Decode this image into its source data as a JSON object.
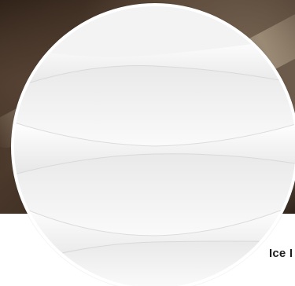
{
  "profile": {
    "name": "Ice I",
    "avatar_description": "white-wave-pattern"
  },
  "banner": {
    "image": "blurred-dark-brown-photo"
  },
  "colors": {
    "avatar_border": "#ffffff",
    "avatar_bg": "#f2f2f2",
    "banner_dark": "#2b1e15",
    "name_text": "#1f1f1f"
  }
}
